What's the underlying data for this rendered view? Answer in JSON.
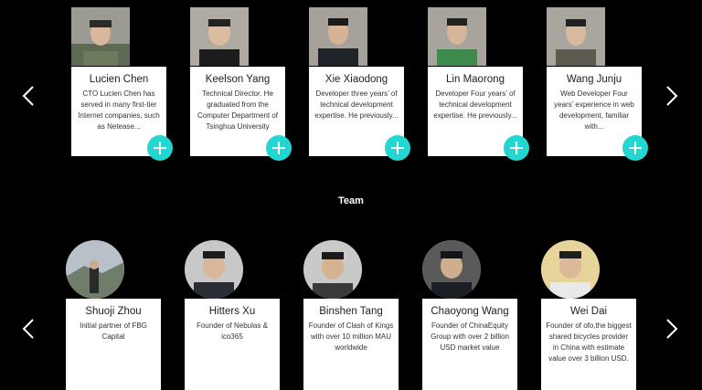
{
  "advisors": [
    {
      "name": "Lucien Chen",
      "desc": "CTO Lucien Chen has served in many first-tier Internet companies, such as Netease..."
    },
    {
      "name": "Keelson Yang",
      "desc": "Technical Director. He graduated from the Computer Department of Tsinghua University"
    },
    {
      "name": "Xie Xiaodong",
      "desc": "Developer three years’ of technical development expertise. He previously..."
    },
    {
      "name": "Lin Maorong",
      "desc": "Developer Four years’ of technical development expertise. He previously..."
    },
    {
      "name": "Wang Junju",
      "desc": "Web Developer Four years’ experience in web development, familiar with..."
    }
  ],
  "team_title": "Team",
  "team": [
    {
      "name": "Shuoji Zhou",
      "desc": "Initial partner of FBG Capital"
    },
    {
      "name": "Hitters Xu",
      "desc": "Founder of Nebulas & ico365"
    },
    {
      "name": "Binshen Tang",
      "desc": "Founder of Clash of Kings with over 10 million MAU worldwide"
    },
    {
      "name": "Chaoyong Wang",
      "desc": "Founder of ChinaEquity Group with over 2 billion USD market value"
    },
    {
      "name": "Wei Dai",
      "desc": "Founder of ofo,the biggest shared bicycles provider in China with estimate value over 3 billion USD."
    }
  ],
  "colors": {
    "background": "#000000",
    "accent": "#22d6d2",
    "card": "#ffffff"
  }
}
